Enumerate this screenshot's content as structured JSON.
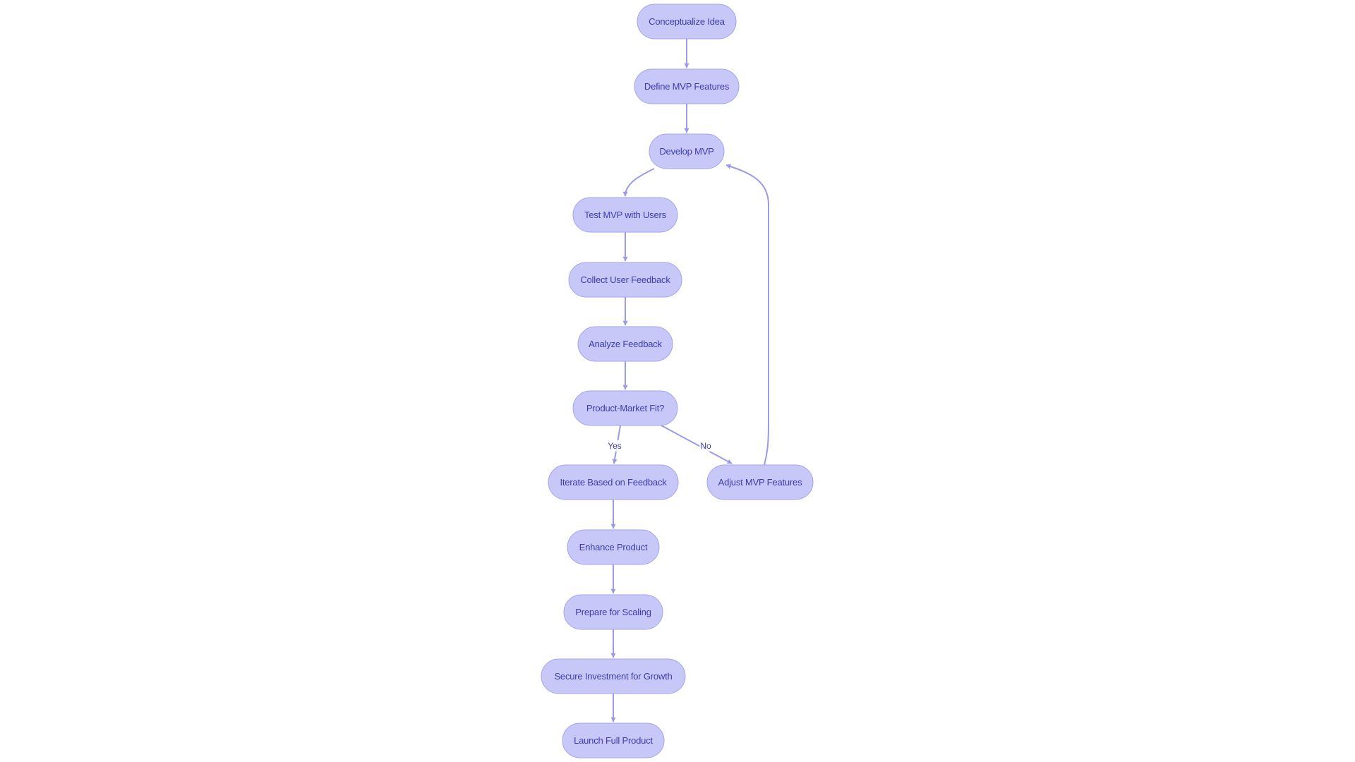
{
  "diagram": {
    "type": "flowchart",
    "direction": "top-down",
    "colors": {
      "node_fill": "#c8c8f8",
      "node_stroke": "#a3a3ec",
      "node_text": "#3c3cb0",
      "edge": "#9a9ae6"
    },
    "nodes": [
      {
        "id": "conceptualize",
        "label": "Conceptualize Idea"
      },
      {
        "id": "define",
        "label": "Define MVP Features"
      },
      {
        "id": "develop",
        "label": "Develop MVP"
      },
      {
        "id": "test",
        "label": "Test MVP with Users"
      },
      {
        "id": "collect",
        "label": "Collect User Feedback"
      },
      {
        "id": "analyze",
        "label": "Analyze Feedback"
      },
      {
        "id": "pmf",
        "label": "Product-Market Fit?"
      },
      {
        "id": "iterate",
        "label": "Iterate Based on Feedback"
      },
      {
        "id": "adjust",
        "label": "Adjust MVP Features"
      },
      {
        "id": "enhance",
        "label": "Enhance Product"
      },
      {
        "id": "prepare",
        "label": "Prepare for Scaling"
      },
      {
        "id": "secure",
        "label": "Secure Investment for Growth"
      },
      {
        "id": "launch",
        "label": "Launch Full Product"
      }
    ],
    "edges": [
      {
        "from": "conceptualize",
        "to": "define",
        "label": ""
      },
      {
        "from": "define",
        "to": "develop",
        "label": ""
      },
      {
        "from": "develop",
        "to": "test",
        "label": ""
      },
      {
        "from": "test",
        "to": "collect",
        "label": ""
      },
      {
        "from": "collect",
        "to": "analyze",
        "label": ""
      },
      {
        "from": "analyze",
        "to": "pmf",
        "label": ""
      },
      {
        "from": "pmf",
        "to": "iterate",
        "label": "Yes"
      },
      {
        "from": "pmf",
        "to": "adjust",
        "label": "No"
      },
      {
        "from": "adjust",
        "to": "develop",
        "label": ""
      },
      {
        "from": "iterate",
        "to": "enhance",
        "label": ""
      },
      {
        "from": "enhance",
        "to": "prepare",
        "label": ""
      },
      {
        "from": "prepare",
        "to": "secure",
        "label": ""
      },
      {
        "from": "secure",
        "to": "launch",
        "label": ""
      }
    ]
  }
}
